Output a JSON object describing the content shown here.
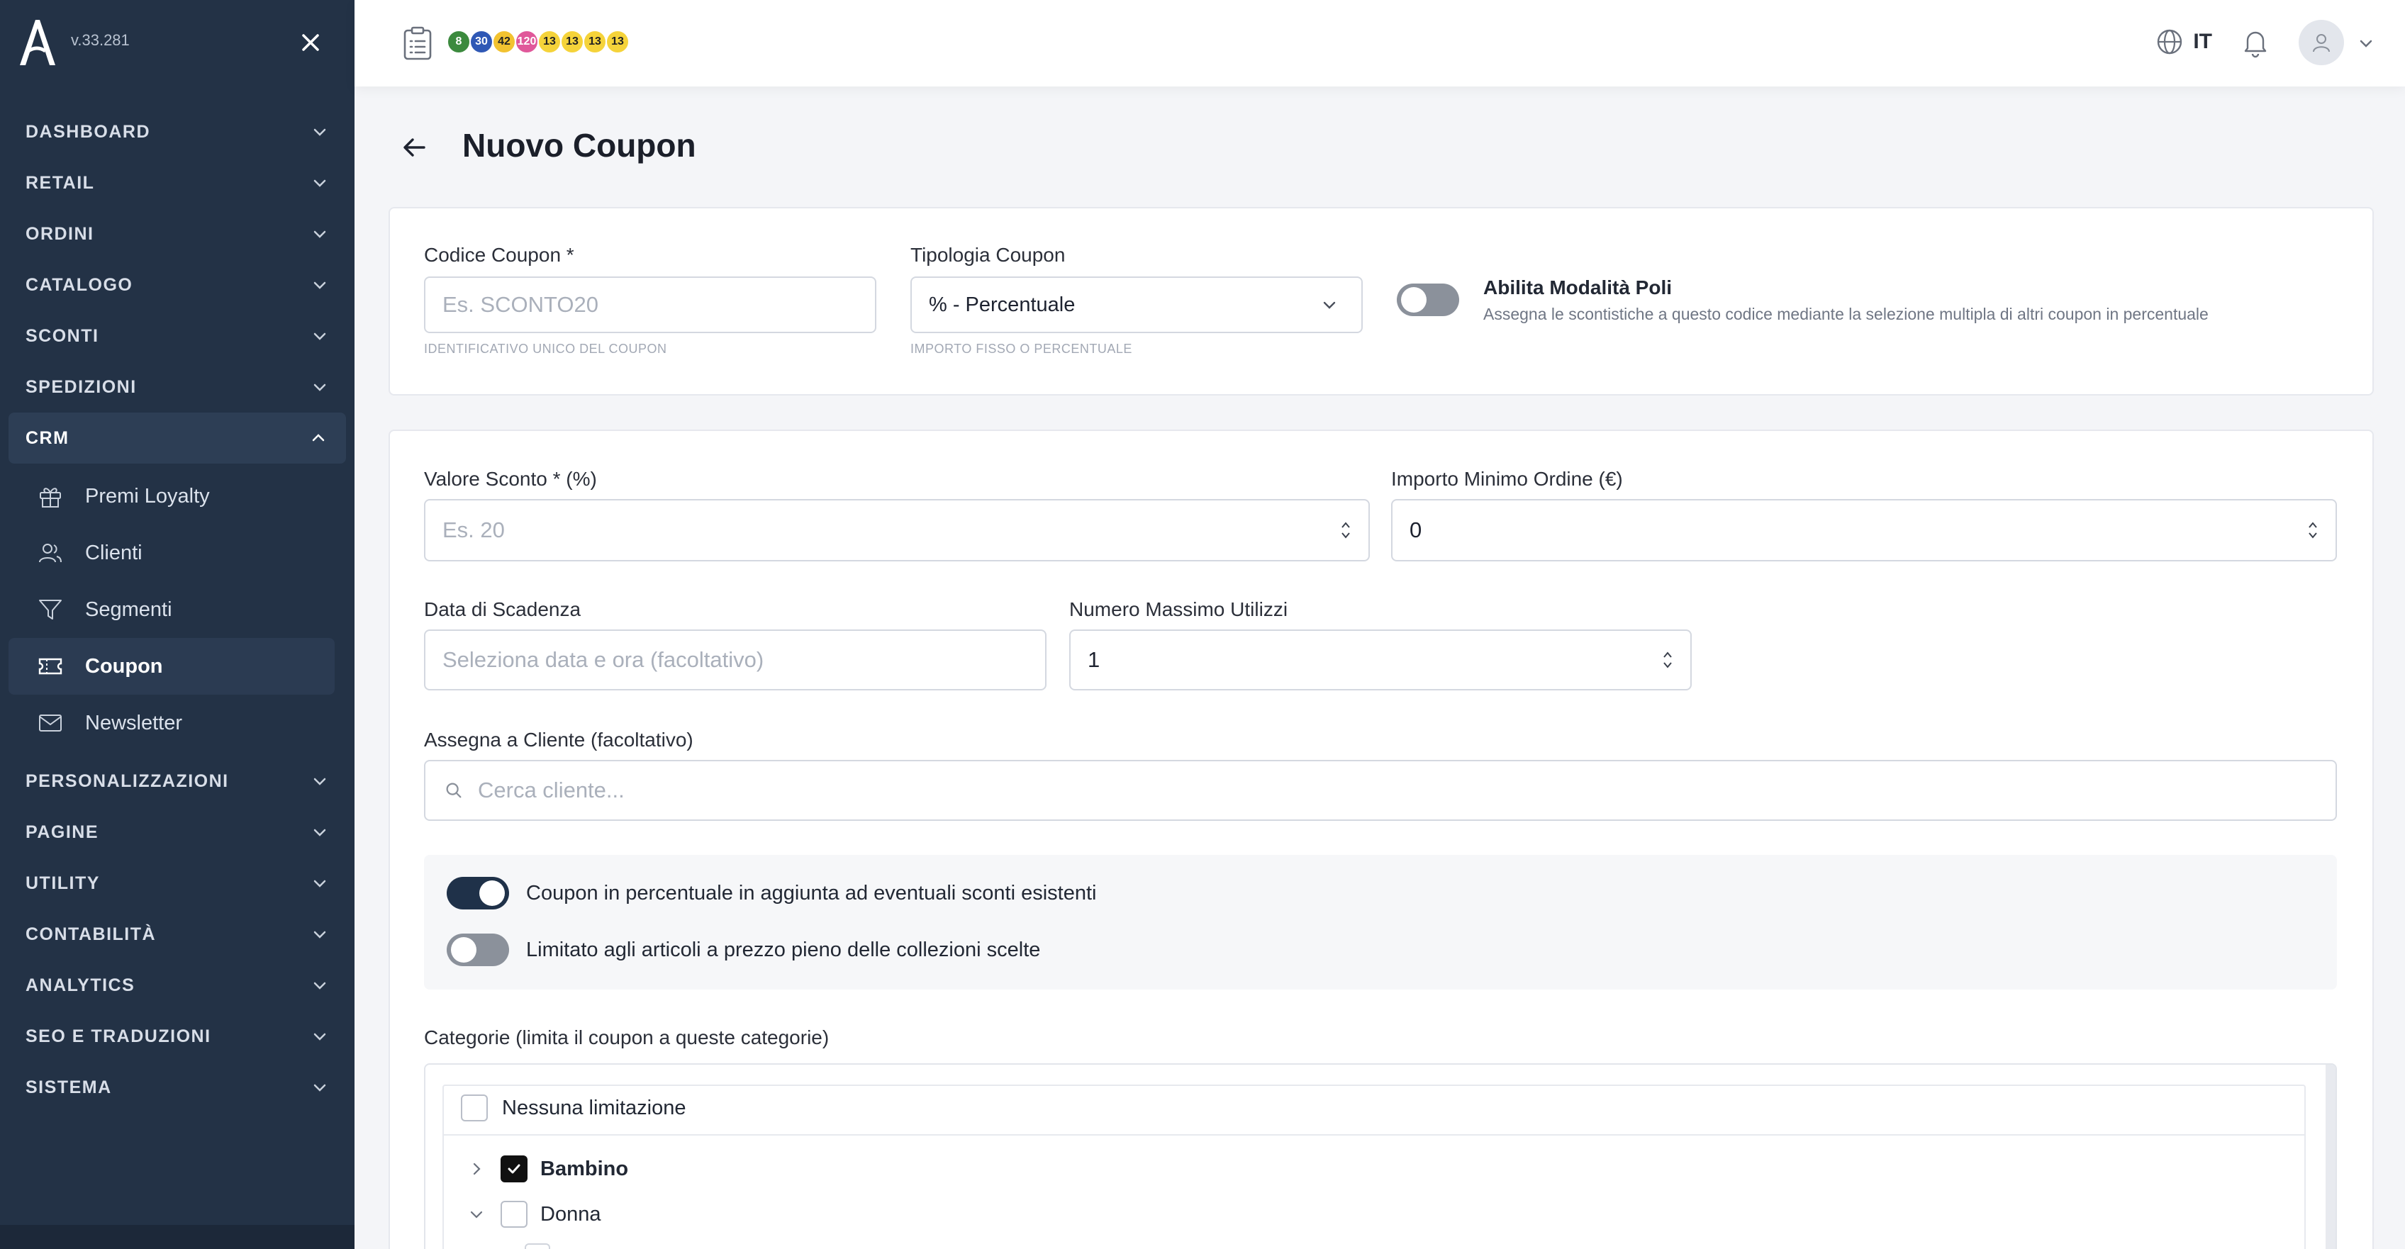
{
  "sidebar": {
    "version": "v.33.281",
    "nav": [
      {
        "label": "DASHBOARD"
      },
      {
        "label": "RETAIL"
      },
      {
        "label": "ORDINI"
      },
      {
        "label": "CATALOGO"
      },
      {
        "label": "SCONTI"
      },
      {
        "label": "SPEDIZIONI"
      },
      {
        "label": "CRM"
      },
      {
        "label": "PERSONALIZZAZIONI"
      },
      {
        "label": "PAGINE"
      },
      {
        "label": "UTILITY"
      },
      {
        "label": "CONTABILITÀ"
      },
      {
        "label": "ANALYTICS"
      },
      {
        "label": "SEO E TRADUZIONI"
      },
      {
        "label": "SISTEMA"
      }
    ],
    "crm_sub": [
      {
        "label": "Premi Loyalty",
        "icon": "gift-icon"
      },
      {
        "label": "Clienti",
        "icon": "users-icon"
      },
      {
        "label": "Segmenti",
        "icon": "filter-icon"
      },
      {
        "label": "Coupon",
        "icon": "ticket-icon"
      },
      {
        "label": "Newsletter",
        "icon": "mail-icon"
      }
    ]
  },
  "topbar": {
    "badges": [
      {
        "text": "8",
        "bg": "#3c8a3e",
        "fg": "#ffffff"
      },
      {
        "text": "30",
        "bg": "#2f58b5",
        "fg": "#ffffff"
      },
      {
        "text": "42",
        "bg": "#f2c230",
        "fg": "#222222"
      },
      {
        "text": "120",
        "bg": "#e0589a",
        "fg": "#ffffff"
      },
      {
        "text": "13",
        "bg": "#f5d33a",
        "fg": "#222222"
      },
      {
        "text": "13",
        "bg": "#f5d33a",
        "fg": "#222222"
      },
      {
        "text": "13",
        "bg": "#f5d33a",
        "fg": "#222222"
      },
      {
        "text": "13",
        "bg": "#f5d33a",
        "fg": "#222222"
      }
    ],
    "language": "IT"
  },
  "page": {
    "title": "Nuovo Coupon"
  },
  "form": {
    "code_label": "Codice Coupon *",
    "code_placeholder": "Es. SCONTO20",
    "code_hint": "IDENTIFICATIVO UNICO DEL COUPON",
    "type_label": "Tipologia Coupon",
    "type_value": "% - Percentuale",
    "type_hint": "IMPORTO FISSO O PERCENTUALE",
    "poli_title": "Abilita Modalità Poli",
    "poli_desc": "Assegna le scontistiche a questo codice mediante la selezione multipla di altri coupon in percentuale",
    "discount_label": "Valore Sconto * (%)",
    "discount_placeholder": "Es. 20",
    "min_order_label": "Importo Minimo Ordine (€)",
    "min_order_value": "0",
    "expiry_label": "Data di Scadenza",
    "expiry_placeholder": "Seleziona data e ora (facoltativo)",
    "max_uses_label": "Numero Massimo Utilizzi",
    "max_uses_value": "1",
    "customer_label": "Assegna a Cliente (facoltativo)",
    "customer_placeholder": "Cerca cliente...",
    "opt_stack_label": "Coupon in percentuale in aggiunta ad eventuali sconti esistenti",
    "opt_fullprice_label": "Limitato agli articoli a prezzo pieno delle collezioni scelte",
    "categories_label": "Categorie (limita il coupon a queste categorie)",
    "cat_none": "Nessuna limitazione",
    "cat_items": [
      {
        "label": "Bambino",
        "checked": true
      },
      {
        "label": "Donna",
        "checked": false
      }
    ]
  }
}
